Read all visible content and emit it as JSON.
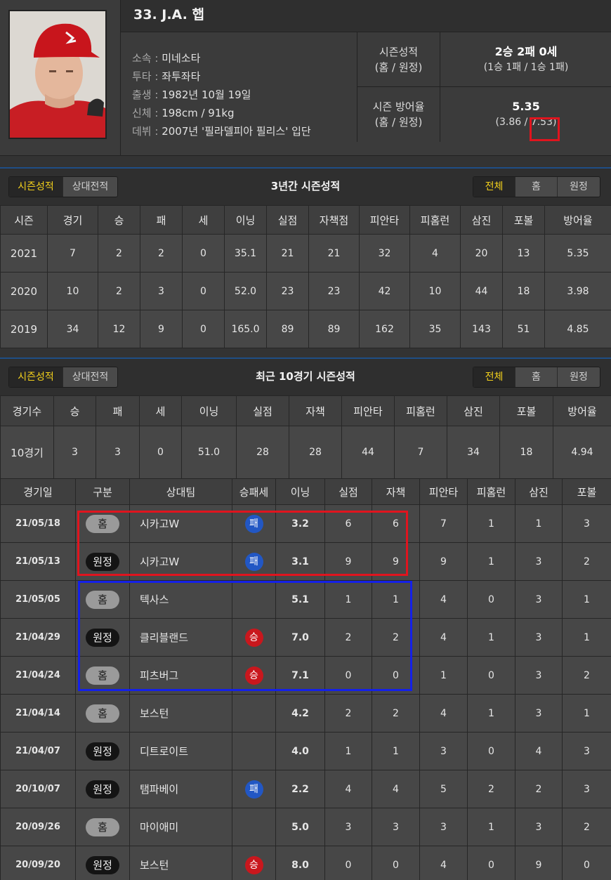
{
  "player": {
    "name": "33. J.A. 햅",
    "info": [
      {
        "label": "소속",
        "value": "미네소타"
      },
      {
        "label": "투타",
        "value": "좌투좌타"
      },
      {
        "label": "출생",
        "value": "1982년 10월 19일"
      },
      {
        "label": "신체",
        "value": "198cm / 91kg"
      },
      {
        "label": "데뷔",
        "value": "2007년 '필라델피아 필리스' 입단"
      }
    ],
    "summary": {
      "record_label": [
        "시즌성적",
        "(홈 / 원정)"
      ],
      "record_main": "2승 2패 0세",
      "record_sub": "(1승 1패 / 1승 1패)",
      "era_label": [
        "시즌 방어율",
        "(홈 / 원정)"
      ],
      "era_main": "5.35",
      "era_sub": "(3.86 / 7.53)"
    }
  },
  "tabs": {
    "season": "시즌성적",
    "versus": "상대전적"
  },
  "filters": [
    "전체",
    "홈",
    "원정"
  ],
  "season_section": {
    "title": "3년간 시즌성적",
    "headers": [
      "시즌",
      "경기",
      "승",
      "패",
      "세",
      "이닝",
      "실점",
      "자책점",
      "피안타",
      "피홈런",
      "삼진",
      "포볼",
      "방어율"
    ],
    "rows": [
      [
        "2021",
        "7",
        "2",
        "2",
        "0",
        "35.1",
        "21",
        "21",
        "32",
        "4",
        "20",
        "13",
        "5.35"
      ],
      [
        "2020",
        "10",
        "2",
        "3",
        "0",
        "52.0",
        "23",
        "23",
        "42",
        "10",
        "44",
        "18",
        "3.98"
      ],
      [
        "2019",
        "34",
        "12",
        "9",
        "0",
        "165.0",
        "89",
        "89",
        "162",
        "35",
        "143",
        "51",
        "4.85"
      ]
    ]
  },
  "recent_section": {
    "title": "최근 10경기 시즌성적",
    "summary_headers": [
      "경기수",
      "승",
      "패",
      "세",
      "이닝",
      "실점",
      "자책",
      "피안타",
      "피홈런",
      "삼진",
      "포볼",
      "방어율"
    ],
    "summary_row": [
      "10경기",
      "3",
      "3",
      "0",
      "51.0",
      "28",
      "28",
      "44",
      "7",
      "34",
      "18",
      "4.94"
    ],
    "game_headers": [
      "경기일",
      "구분",
      "상대팀",
      "승패세",
      "이닝",
      "실점",
      "자책",
      "피안타",
      "피홈런",
      "삼진",
      "포볼"
    ],
    "games": [
      {
        "date": "21/05/18",
        "loc": "홈",
        "opp": "시카고W",
        "dec": "패",
        "ip": "3.2",
        "r": "6",
        "er": "6",
        "h": "7",
        "hr": "1",
        "so": "1",
        "bb": "3"
      },
      {
        "date": "21/05/13",
        "loc": "원정",
        "opp": "시카고W",
        "dec": "패",
        "ip": "3.1",
        "r": "9",
        "er": "9",
        "h": "9",
        "hr": "1",
        "so": "3",
        "bb": "2"
      },
      {
        "date": "21/05/05",
        "loc": "홈",
        "opp": "텍사스",
        "dec": "",
        "ip": "5.1",
        "r": "1",
        "er": "1",
        "h": "4",
        "hr": "0",
        "so": "3",
        "bb": "1"
      },
      {
        "date": "21/04/29",
        "loc": "원정",
        "opp": "클리블랜드",
        "dec": "승",
        "ip": "7.0",
        "r": "2",
        "er": "2",
        "h": "4",
        "hr": "1",
        "so": "3",
        "bb": "1"
      },
      {
        "date": "21/04/24",
        "loc": "홈",
        "opp": "피츠버그",
        "dec": "승",
        "ip": "7.1",
        "r": "0",
        "er": "0",
        "h": "1",
        "hr": "0",
        "so": "3",
        "bb": "2"
      },
      {
        "date": "21/04/14",
        "loc": "홈",
        "opp": "보스턴",
        "dec": "",
        "ip": "4.2",
        "r": "2",
        "er": "2",
        "h": "4",
        "hr": "1",
        "so": "3",
        "bb": "1"
      },
      {
        "date": "21/04/07",
        "loc": "원정",
        "opp": "디트로이트",
        "dec": "",
        "ip": "4.0",
        "r": "1",
        "er": "1",
        "h": "3",
        "hr": "0",
        "so": "4",
        "bb": "3"
      },
      {
        "date": "20/10/07",
        "loc": "원정",
        "opp": "탬파베이",
        "dec": "패",
        "ip": "2.2",
        "r": "4",
        "er": "4",
        "h": "5",
        "hr": "2",
        "so": "2",
        "bb": "3"
      },
      {
        "date": "20/09/26",
        "loc": "홈",
        "opp": "마이애미",
        "dec": "",
        "ip": "5.0",
        "r": "3",
        "er": "3",
        "h": "3",
        "hr": "1",
        "so": "3",
        "bb": "2"
      },
      {
        "date": "20/09/20",
        "loc": "원정",
        "opp": "보스턴",
        "dec": "승",
        "ip": "8.0",
        "r": "0",
        "er": "0",
        "h": "4",
        "hr": "0",
        "so": "9",
        "bb": "0"
      }
    ]
  },
  "colors": {
    "accent_yellow": "#f2d01c",
    "win": "#c9171d",
    "loss": "#2257c4",
    "highlight_red": "#e0141e",
    "highlight_blue": "#1420e8"
  }
}
